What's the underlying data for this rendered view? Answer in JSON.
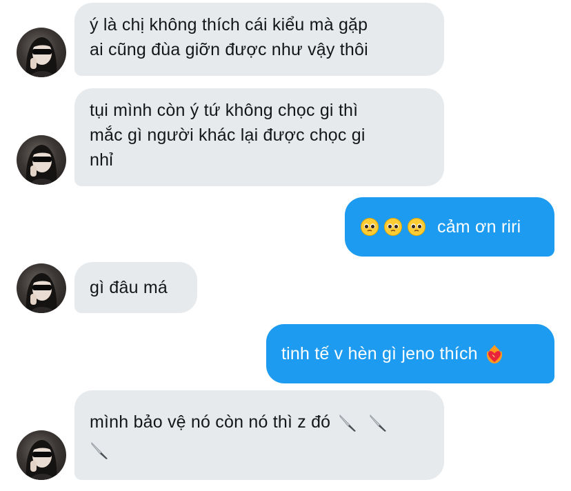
{
  "messages": [
    {
      "text": "ý là chị không thích cái kiểu mà gặp\nai cũng đùa giỡn được như vậy thôi"
    },
    {
      "text": "tụi mình còn ý tứ không chọc gi thì\nmắc gì người khác lại được chọc gi\nnhỉ"
    },
    {
      "text": "cảm ơn riri",
      "emoji": [
        "pleading-face",
        "pleading-face",
        "pleading-face"
      ]
    },
    {
      "text": "gì đâu má"
    },
    {
      "text": "tinh tế v hèn gì jeno thích",
      "emoji": [
        "heart-on-fire"
      ]
    },
    {
      "text": "mình bảo vệ nó còn nó thì z đó",
      "emoji": [
        "knife",
        "knife",
        "knife"
      ]
    }
  ],
  "colors": {
    "incoming_bubble": "#e7eaed",
    "outgoing_bubble": "#1d9bf0",
    "incoming_text": "#14171a",
    "outgoing_text": "#ffffff"
  }
}
